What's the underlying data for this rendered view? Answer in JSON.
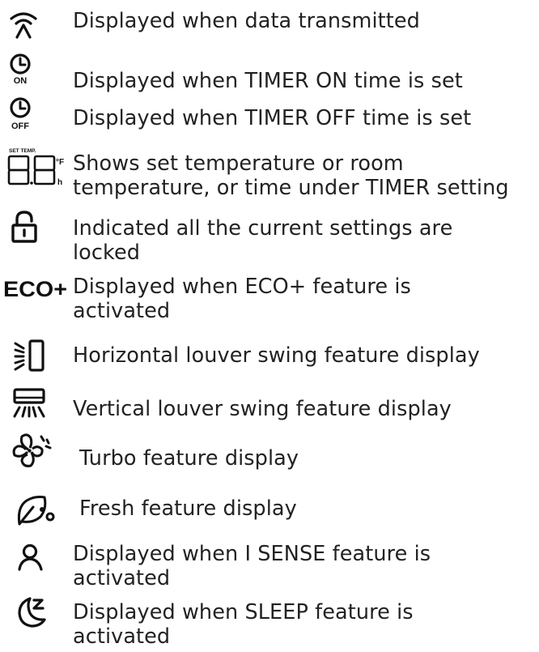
{
  "legend": {
    "items": [
      {
        "icon": "signal-icon",
        "lines": [
          "Displayed when data transmitted"
        ]
      },
      {
        "icon": "timer-on-icon",
        "icon_caption": "ON",
        "lines": [
          "Displayed when TIMER ON time is set"
        ]
      },
      {
        "icon": "timer-off-icon",
        "icon_caption": "OFF",
        "lines": [
          "Displayed when TIMER OFF time is set"
        ]
      },
      {
        "icon": "temperature-display-icon",
        "icon_caption": "SET TEMP.",
        "icon_units": [
          "°F",
          "h"
        ],
        "lines": [
          "Shows set temperature or room",
          "temperature, or time under TIMER setting"
        ]
      },
      {
        "icon": "lock-icon",
        "lines": [
          "Indicated all the current settings are",
          "locked"
        ]
      },
      {
        "icon": "eco-plus-icon",
        "icon_caption": "ECO+",
        "lines": [
          "Displayed when ECO+ feature is",
          "activated"
        ]
      },
      {
        "icon": "horizontal-swing-icon",
        "lines": [
          "Horizontal louver swing feature display"
        ]
      },
      {
        "icon": "vertical-swing-icon",
        "lines": [
          "Vertical louver swing feature display"
        ]
      },
      {
        "icon": "turbo-icon",
        "lines": [
          "Turbo feature display"
        ]
      },
      {
        "icon": "fresh-icon",
        "lines": [
          "Fresh feature display"
        ]
      },
      {
        "icon": "i-sense-icon",
        "lines": [
          "Displayed when I SENSE feature is",
          "activated"
        ]
      },
      {
        "icon": "sleep-icon",
        "lines": [
          "Displayed when SLEEP feature is",
          "activated"
        ]
      }
    ]
  }
}
